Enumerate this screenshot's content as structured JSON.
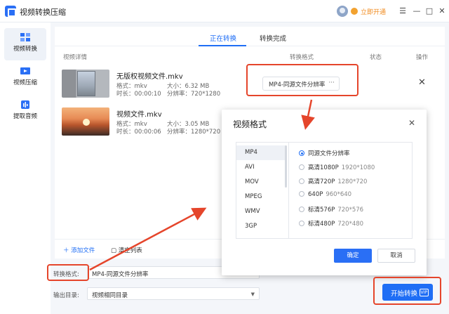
{
  "app": {
    "title": "视频转换压缩",
    "open_vip": "立即开通"
  },
  "window": {
    "menu_glyph": "☰",
    "minimize_glyph": "—",
    "maximize_glyph": "□",
    "close_glyph": "✕"
  },
  "sidebar": {
    "items": [
      {
        "label": "视频转换",
        "icon": "video-convert-icon",
        "active": true
      },
      {
        "label": "视频压缩",
        "icon": "video-compress-icon",
        "active": false
      },
      {
        "label": "提取音频",
        "icon": "audio-extract-icon",
        "active": false
      }
    ]
  },
  "tabs": [
    {
      "label": "正在转换",
      "active": true
    },
    {
      "label": "转换完成",
      "active": false
    }
  ],
  "columns": {
    "details": "视频详情",
    "format": "转换格式",
    "status": "状态",
    "actions": "操作"
  },
  "files": [
    {
      "name": "无版权视频文件.mkv",
      "format_label": "格式：mkv",
      "duration_label": "时长：00:00:10",
      "size_label": "大小：6.32 MB",
      "resolution_label": "分辨率：720*1280",
      "target_format": "MP4-同源文件分辨率",
      "more": "···",
      "delete_glyph": "✕"
    },
    {
      "name": "视频文件.mkv",
      "format_label": "格式：mkv",
      "duration_label": "时长：00:00:06",
      "size_label": "大小：3.05 MB",
      "resolution_label": "分辨率：1280*720"
    }
  ],
  "footer": {
    "add_file": "＋ 添加文件",
    "clear_list": "清空列表"
  },
  "form": {
    "convert_format_label": "转换格式:",
    "convert_format_value": "MP4-同源文件分辨率",
    "output_dir_label": "输出目录:",
    "output_dir_value": "视频相同目录",
    "caret": "▼"
  },
  "start_button": {
    "label": "开始转换",
    "badge": "VIP"
  },
  "dialog": {
    "title": "视频格式",
    "close_glyph": "✕",
    "formats": [
      "MP4",
      "AVI",
      "MOV",
      "MPEG",
      "WMV",
      "3GP"
    ],
    "selected_format": "MP4",
    "resolutions": [
      {
        "name": "同源文件分辨率",
        "detail": "",
        "selected": true
      },
      {
        "name": "高清1080P",
        "detail": "1920*1080",
        "selected": false
      },
      {
        "name": "高清720P",
        "detail": "1280*720",
        "selected": false
      },
      {
        "name": "640P",
        "detail": "960*640",
        "selected": false
      },
      {
        "name": "标清576P",
        "detail": "720*576",
        "selected": false
      },
      {
        "name": "标清480P",
        "detail": "720*480",
        "selected": false
      }
    ],
    "ok_label": "确定",
    "cancel_label": "取消"
  },
  "colors": {
    "accent": "#1f6ef5",
    "annotation": "#e5452b",
    "vip": "#f08a1d"
  }
}
